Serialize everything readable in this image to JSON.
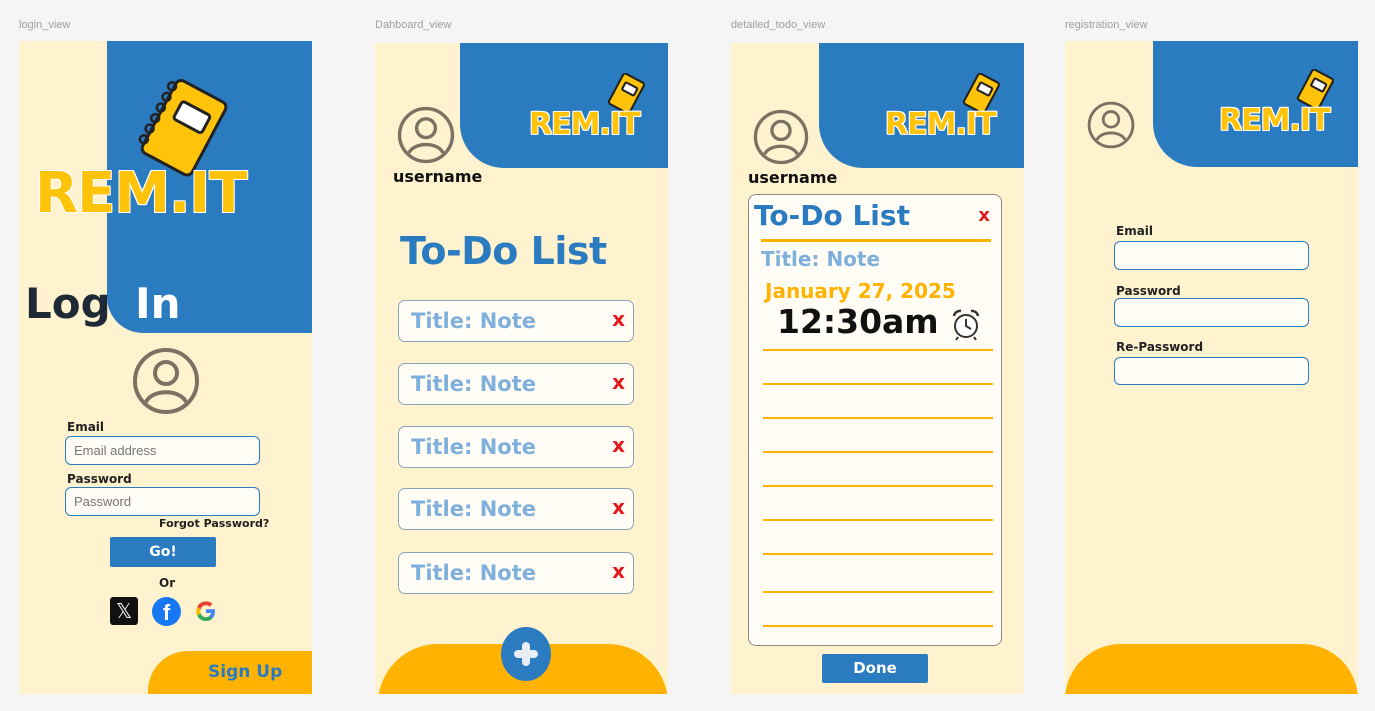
{
  "frames": {
    "login": "login_view",
    "dashboard": "Dahboard_view",
    "detail": "detailed_todo_view",
    "registration": "registration_view"
  },
  "brand": {
    "name": "REM.IT",
    "primary": "#2a7bc0",
    "accent": "#ffc30a",
    "background": "#fff2cf"
  },
  "login": {
    "heading_log": "Log",
    "heading_in": "In",
    "email_label": "Email",
    "email_placeholder": "Email address",
    "password_label": "Password",
    "password_placeholder": "Password",
    "forgot": "Forgot Password?",
    "go": "Go!",
    "or": "Or",
    "social_icons": [
      "x-icon",
      "facebook-icon",
      "google-icon"
    ],
    "signup": "Sign Up"
  },
  "dashboard": {
    "username": "username",
    "heading": "To-Do List",
    "notes": [
      "Title: Note",
      "Title: Note",
      "Title: Note",
      "Title: Note",
      "Title: Note"
    ],
    "delete": "x"
  },
  "detail": {
    "username": "username",
    "heading": "To-Do List",
    "close": "x",
    "title": "Title: Note",
    "date": "January 27, 2025",
    "time": "12:30am",
    "done": "Done"
  },
  "registration": {
    "email_label": "Email",
    "password_label": "Password",
    "repassword_label": "Re-Password"
  }
}
